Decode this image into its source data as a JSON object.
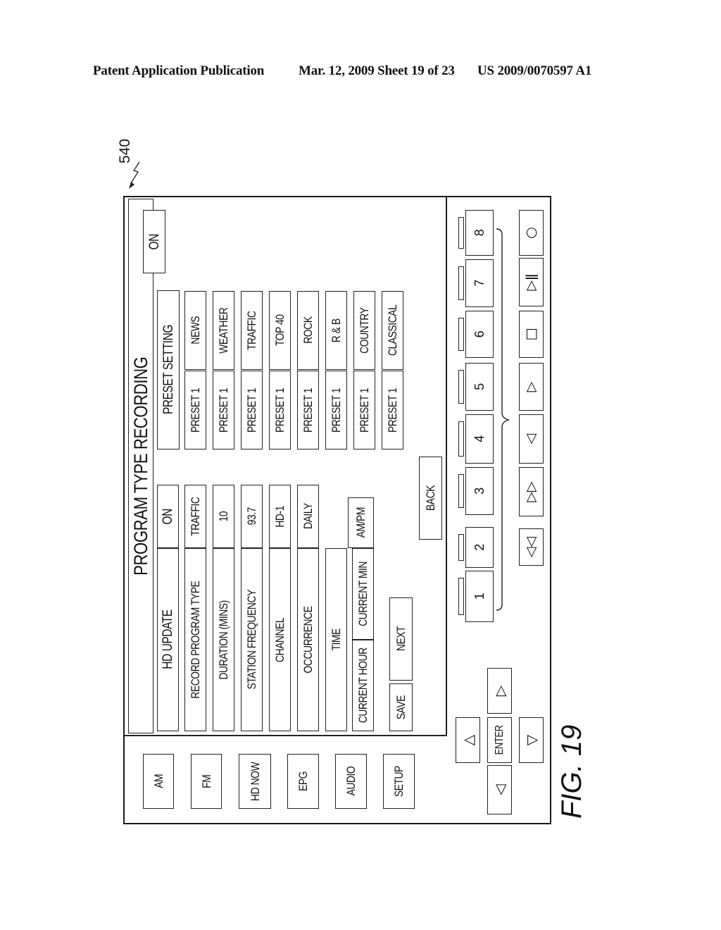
{
  "header": {
    "left": "Patent Application Publication",
    "middle": "Mar. 12, 2009  Sheet 19 of 23",
    "right": "US 2009/0070597 A1"
  },
  "figure": {
    "reference_number": "540",
    "label": "FIG. 19"
  },
  "screen": {
    "title": "PROGRAM TYPE RECORDING",
    "nav": [
      "AM",
      "FM",
      "HD NOW",
      "EPG",
      "AUDIO",
      "SETUP"
    ],
    "settings": [
      {
        "label": "HD UPDATE",
        "value": "ON"
      },
      {
        "label": "RECORD PROGRAM TYPE",
        "value": "TRAFFIC"
      },
      {
        "label": "DURATION (MINS)",
        "value": "10"
      },
      {
        "label": "STATION FREQUENCY",
        "value": "93.7"
      },
      {
        "label": "CHANNEL",
        "value": "HD-1"
      },
      {
        "label": "OCCURRENCE",
        "value": "DAILY"
      },
      {
        "label": "TIME",
        "value": ""
      }
    ],
    "time_fields": [
      "CURRENT HOUR",
      "CURRENT MIN",
      "AM/PM"
    ],
    "actions": {
      "save": "SAVE",
      "next": "NEXT",
      "back": "BACK"
    },
    "preset_setting": {
      "header": "PRESET SETTING",
      "toggle": "ON",
      "rows": [
        {
          "preset": "PRESET 1",
          "program_type": "NEWS"
        },
        {
          "preset": "PRESET 1",
          "program_type": "WEATHER"
        },
        {
          "preset": "PRESET 1",
          "program_type": "TRAFFIC"
        },
        {
          "preset": "PRESET 1",
          "program_type": "TOP 40"
        },
        {
          "preset": "PRESET 1",
          "program_type": "ROCK"
        },
        {
          "preset": "PRESET 1",
          "program_type": "R & B"
        },
        {
          "preset": "PRESET 1",
          "program_type": "COUNTRY"
        },
        {
          "preset": "PRESET 1",
          "program_type": "CLASSICAL"
        }
      ]
    },
    "dpad": {
      "up": "up-triangle-icon",
      "down": "down-triangle-icon",
      "left": "left-triangle-icon",
      "right": "right-triangle-icon",
      "enter": "ENTER",
      "glyphs": {
        "up": "△",
        "down": "▽",
        "left": "◁",
        "right": "▷"
      }
    },
    "preset_keys": [
      "1",
      "2",
      "3",
      "4",
      "5",
      "6",
      "7",
      "8"
    ],
    "transport": [
      {
        "name": "rewind",
        "glyph": "◁◁"
      },
      {
        "name": "fast-forward",
        "glyph": "▷▷"
      },
      {
        "name": "reverse-play",
        "glyph": "◁"
      },
      {
        "name": "play",
        "glyph": "▷"
      },
      {
        "name": "stop",
        "glyph": "□"
      },
      {
        "name": "play-pause",
        "glyph": "▷ǁ"
      },
      {
        "name": "record",
        "glyph": "○"
      }
    ]
  }
}
